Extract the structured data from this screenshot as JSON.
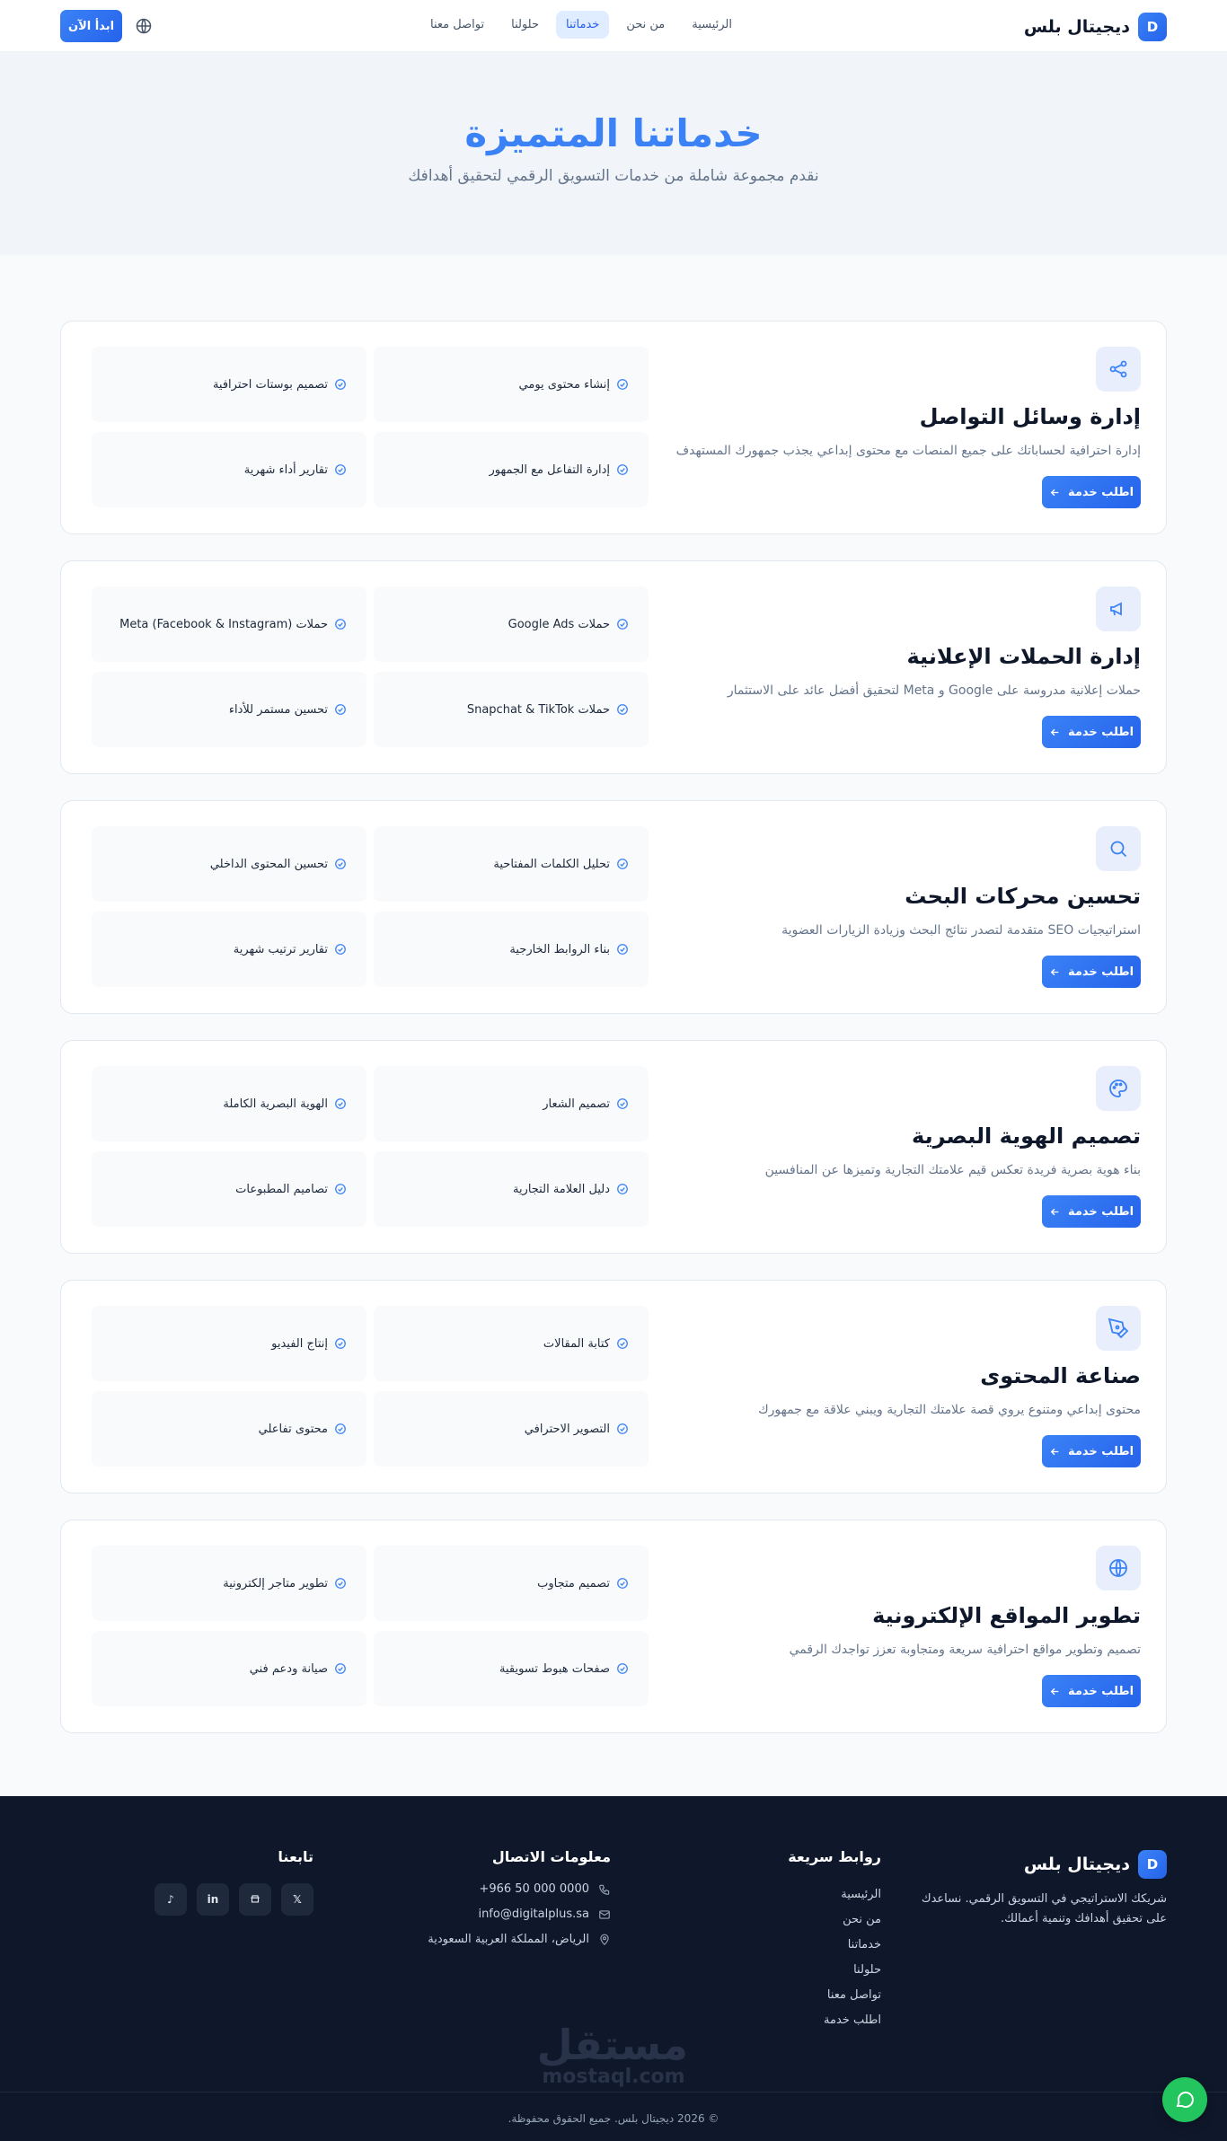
{
  "header": {
    "brand_letter": "D",
    "brand_name": "ديجيتال بلس",
    "nav": [
      "الرئيسية",
      "من نحن",
      "خدماتنا",
      "حلولنا",
      "تواصل معنا"
    ],
    "active_nav": "خدماتنا",
    "cta_label": "ابدأ الآن",
    "language_icon": "globe-icon"
  },
  "hero": {
    "title": "خدماتنا المتميزة",
    "subtitle": "نقدم مجموعة شاملة من خدمات التسويق الرقمي لتحقيق أهدافك"
  },
  "colors": {
    "accent": "#3b82f6",
    "footer_bg": "#0f172a",
    "chat": "#22c55e"
  },
  "services": [
    {
      "icon": "share-icon",
      "title": "إدارة وسائل التواصل",
      "description": "إدارة احترافية لحساباتك على جميع المنصات مع محتوى إبداعي يجذب جمهورك المستهدف",
      "button": "اطلب خدمة",
      "features": [
        "إنشاء محتوى يومي",
        "تصميم بوستات احترافية",
        "إدارة التفاعل مع الجمهور",
        "تقارير أداء شهرية"
      ]
    },
    {
      "icon": "megaphone-icon",
      "title": "إدارة الحملات الإعلانية",
      "description": "حملات إعلانية مدروسة على Google و Meta لتحقيق أفضل عائد على الاستثمار",
      "button": "اطلب خدمة",
      "features": [
        "حملات Google Ads",
        "حملات Meta (Facebook & Instagram)",
        "حملات Snapchat & TikTok",
        "تحسين مستمر للأداء"
      ]
    },
    {
      "icon": "search-icon",
      "title": "تحسين محركات البحث",
      "description": "استراتيجيات SEO متقدمة لتصدر نتائج البحث وزيادة الزيارات العضوية",
      "button": "اطلب خدمة",
      "features": [
        "تحليل الكلمات المفتاحية",
        "تحسين المحتوى الداخلي",
        "بناء الروابط الخارجية",
        "تقارير ترتيب شهرية"
      ]
    },
    {
      "icon": "palette-icon",
      "title": "تصميم الهوية البصرية",
      "description": "بناء هوية بصرية فريدة تعكس قيم علامتك التجارية وتميزها عن المنافسين",
      "button": "اطلب خدمة",
      "features": [
        "تصميم الشعار",
        "الهوية البصرية الكاملة",
        "دليل العلامة التجارية",
        "تصاميم المطبوعات"
      ]
    },
    {
      "icon": "pen-tool-icon",
      "title": "صناعة المحتوى",
      "description": "محتوى إبداعي ومتنوع يروي قصة علامتك التجارية ويبني علاقة مع جمهورك",
      "button": "اطلب خدمة",
      "features": [
        "كتابة المقالات",
        "إنتاج الفيديو",
        "التصوير الاحترافي",
        "محتوى تفاعلي"
      ]
    },
    {
      "icon": "globe-icon",
      "title": "تطوير المواقع الإلكترونية",
      "description": "تصميم وتطوير مواقع احترافية سريعة ومتجاوبة تعزز تواجدك الرقمي",
      "button": "اطلب خدمة",
      "features": [
        "تصميم متجاوب",
        "تطوير متاجر إلكترونية",
        "صفحات هبوط تسويقية",
        "صيانة ودعم فني"
      ]
    }
  ],
  "footer": {
    "brand_letter": "D",
    "brand_name": "ديجيتال بلس",
    "about": "شريكك الاستراتيجي في التسويق الرقمي. نساعدك على تحقيق أهدافك وتنمية أعمالك.",
    "quick_links_title": "روابط سريعة",
    "quick_links": [
      "الرئيسية",
      "من نحن",
      "خدماتنا",
      "حلولنا",
      "تواصل معنا",
      "اطلب خدمة"
    ],
    "contact_title": "معلومات الاتصال",
    "phone": "+966 50 000 0000",
    "email": "info@digitalplus.sa",
    "address": "الرياض، المملكة العربية السعودية",
    "follow_title": "تابعنا",
    "socials": [
      "X",
      "snapchat",
      "in",
      "tiktok"
    ],
    "watermark_ar": "مستقل",
    "watermark_en": "mostaql.com",
    "copyright": "© 2026 ديجيتال بلس. جميع الحقوق محفوظة."
  }
}
